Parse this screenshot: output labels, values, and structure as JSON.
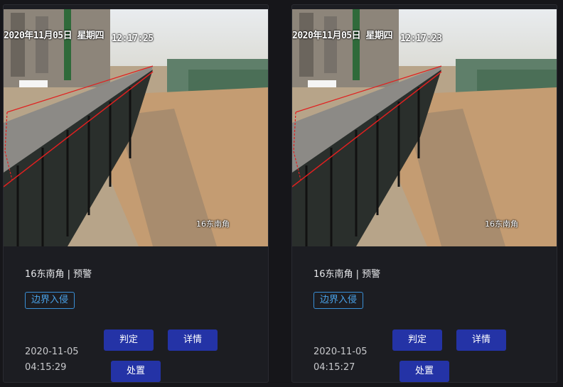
{
  "cards": [
    {
      "overlay_date": "2020年11月05日 星期四",
      "overlay_time": "12:17:25",
      "overlay_camera": "16东南角",
      "title": "16东南角 | 预警",
      "tag": "边界入侵",
      "date": "2020-11-05",
      "time": "04:15:29",
      "btn_judge": "判定",
      "btn_detail": "详情",
      "btn_handle": "处置"
    },
    {
      "overlay_date": "2020年11月05日 星期四",
      "overlay_time": "12:17:23",
      "overlay_camera": "16东南角",
      "title": "16东南角 | 预警",
      "tag": "边界入侵",
      "date": "2020-11-05",
      "time": "04:15:27",
      "btn_judge": "判定",
      "btn_detail": "详情",
      "btn_handle": "处置"
    }
  ],
  "colors": {
    "button": "#2433a6",
    "tag_border": "#3a8fd6",
    "detection_box": "#e02020"
  }
}
